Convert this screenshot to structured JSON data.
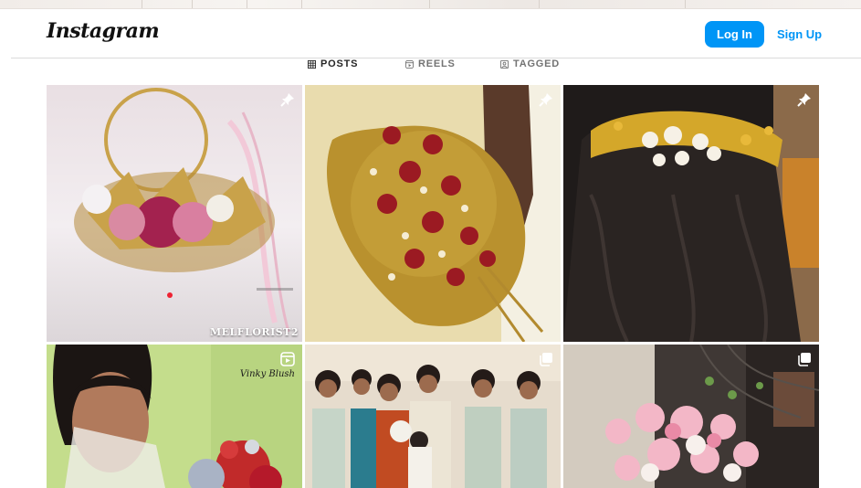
{
  "header": {
    "logo_text": "Instagram",
    "login_label": "Log In",
    "signup_label": "Sign Up"
  },
  "tabs": [
    {
      "label": "POSTS",
      "icon": "grid-icon",
      "active": true
    },
    {
      "label": "REELS",
      "icon": "reels-icon",
      "active": false
    },
    {
      "label": "TAGGED",
      "icon": "tagged-icon",
      "active": false
    }
  ],
  "posts": [
    {
      "description": "bouquet-pink-gold",
      "badge": "pin-icon",
      "caption": "MELFLORIST2"
    },
    {
      "description": "bridal-bouquet-red-gold",
      "badge": "pin-icon"
    },
    {
      "description": "hair-accessory-gold-white",
      "badge": "pin-icon"
    },
    {
      "description": "bride-with-bouquet",
      "badge": "reels-icon",
      "watermark": "Vinky Blush"
    },
    {
      "description": "bridal-party-group",
      "badge": "carousel-icon"
    },
    {
      "description": "pink-flower-arrangement",
      "badge": "carousel-icon"
    }
  ],
  "colors": {
    "brand_blue": "#0095f6",
    "text_dark": "#262626",
    "text_muted": "#737373",
    "divider": "#dbdbdb"
  }
}
